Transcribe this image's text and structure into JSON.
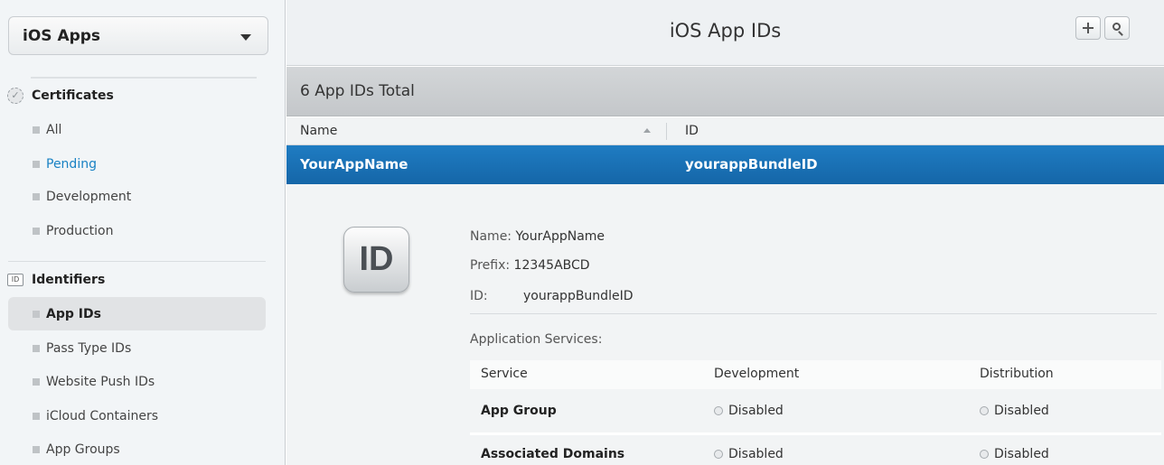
{
  "sidebar": {
    "platform": "iOS Apps",
    "certificates": {
      "title": "Certificates",
      "items": [
        "All",
        "Pending",
        "Development",
        "Production"
      ]
    },
    "identifiers": {
      "title": "Identifiers",
      "icon_text": "ID",
      "items": [
        "App IDs",
        "Pass Type IDs",
        "Website Push IDs",
        "iCloud Containers",
        "App Groups"
      ]
    }
  },
  "header": {
    "title": "iOS App IDs"
  },
  "summary": "6 App IDs Total",
  "table": {
    "columns": [
      "Name",
      "ID"
    ],
    "selected_row": {
      "name": "YourAppName",
      "id": "yourappBundleID"
    }
  },
  "detail": {
    "badge": "ID",
    "name_label": "Name:",
    "name_value": "YourAppName",
    "prefix_label": "Prefix:",
    "prefix_value": "12345ABCD",
    "id_label": "ID:",
    "id_value": "yourappBundleID",
    "services_title": "Application Services:",
    "services_columns": [
      "Service",
      "Development",
      "Distribution"
    ],
    "services": [
      {
        "service": "App Group",
        "development": "Disabled",
        "distribution": "Disabled"
      },
      {
        "service": "Associated Domains",
        "development": "Disabled",
        "distribution": "Disabled"
      }
    ]
  }
}
